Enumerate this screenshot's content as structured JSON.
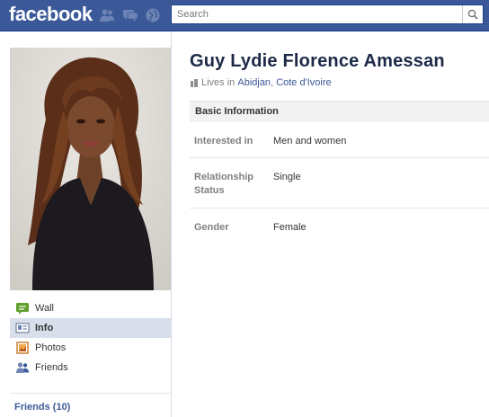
{
  "topbar": {
    "logo_text": "facebook",
    "icons": [
      "friend-requests-icon",
      "messages-icon",
      "notifications-icon"
    ],
    "search": {
      "placeholder": "Search",
      "value": ""
    },
    "colors": {
      "brand": "#3b5998",
      "brand_border": "#1d4088"
    }
  },
  "sidebar": {
    "profile_photo": "profile-photo",
    "items": [
      {
        "label": "Wall",
        "icon": "wall-icon",
        "active": false
      },
      {
        "label": "Info",
        "icon": "info-icon",
        "active": true
      },
      {
        "label": "Photos",
        "icon": "photos-icon",
        "active": false
      },
      {
        "label": "Friends",
        "icon": "friends-icon",
        "active": false
      }
    ],
    "friends_link": "Friends (10)"
  },
  "profile": {
    "name": "Guy Lydie Florence Amessan",
    "lives_prefix": "Lives in",
    "city": "Abidjan",
    "separator": ",",
    "country": "Cote d'Ivoire"
  },
  "basic_info": {
    "heading": "Basic Information",
    "rows": [
      {
        "label": "Interested in",
        "value": "Men and women"
      },
      {
        "label": "Relationship Status",
        "value": "Single"
      },
      {
        "label": "Gender",
        "value": "Female"
      }
    ]
  }
}
